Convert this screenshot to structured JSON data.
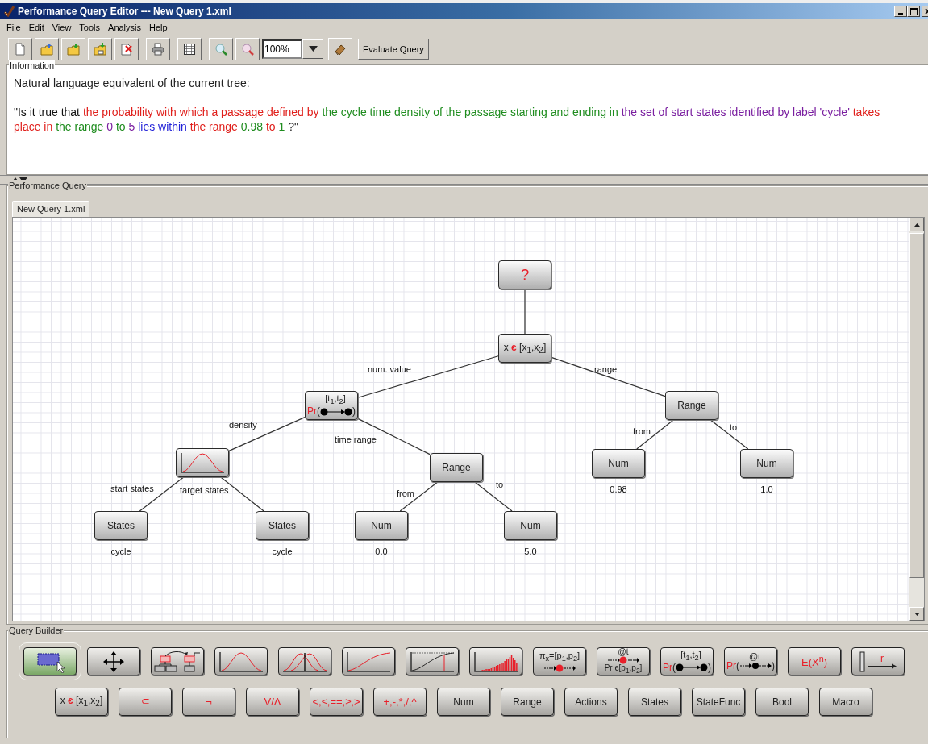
{
  "window": {
    "title": "Performance Query Editor --- New Query 1.xml"
  },
  "menu": [
    "File",
    "Edit",
    "View",
    "Tools",
    "Analysis",
    "Help"
  ],
  "toolbar": [
    {
      "kind": "new"
    },
    {
      "kind": "open"
    },
    {
      "kind": "import"
    },
    {
      "kind": "export"
    },
    {
      "kind": "close-file"
    },
    {
      "kind": "print"
    },
    {
      "kind": "grid"
    },
    {
      "kind": "zoom-in"
    },
    {
      "kind": "zoom-out"
    },
    {
      "kind": "zoom-select",
      "value": "100%"
    },
    {
      "kind": "eraser"
    },
    {
      "kind": "button",
      "label": "Evaluate Query"
    }
  ],
  "information": {
    "title": "Information",
    "heading": "Natural language equivalent of the current tree:",
    "sentence": [
      {
        "text": "\"Is it true that ",
        "color": "#111111"
      },
      {
        "text": "the probability with which a passage defined by ",
        "color": "#e0201c"
      },
      {
        "text": "the cycle time density of the passage starting and ending in ",
        "color": "#1e8c1e"
      },
      {
        "text": "the set of start states identified by label 'cycle' ",
        "color": "#7a1fa0"
      },
      {
        "text": "takes place in ",
        "color": "#e0201c"
      },
      {
        "text": "the range ",
        "color": "#1e8c1e"
      },
      {
        "text": "0",
        "color": "#7a1fa0"
      },
      {
        "text": " to ",
        "color": "#1e8c1e"
      },
      {
        "text": "5",
        "color": "#7a1fa0"
      },
      {
        "text": " lies within ",
        "color": "#2424d8"
      },
      {
        "text": "the range ",
        "color": "#e0201c"
      },
      {
        "text": "0.98",
        "color": "#1e8c1e"
      },
      {
        "text": " to ",
        "color": "#e0201c"
      },
      {
        "text": "1",
        "color": "#1e8c1e"
      },
      {
        "text": " ?\"",
        "color": "#111111"
      }
    ]
  },
  "performance_query": {
    "title": "Performance Query",
    "tabs": [
      {
        "label": "New Query 1.xml",
        "selected": true
      }
    ],
    "tree": {
      "kind": "placeholder",
      "label": "?",
      "children": [
        {
          "kind": "in-range",
          "label": "x",
          "symbol": "є",
          "operand": "[x$_{1}$,x$_{2}$]",
          "children": [
            {
              "kind": "passage",
              "edge": "num. value",
              "prefix": "Pr",
              "open": "(",
              "interval": "[t$_{1}$,t$_{2}$]",
              "close": ")",
              "children": [
                {
                  "kind": "density",
                  "edge": "density",
                  "children": [
                    {
                      "kind": "text",
                      "edge": "start states",
                      "label": "States",
                      "value": "cycle"
                    },
                    {
                      "kind": "text",
                      "edge": "target states",
                      "label": "States",
                      "value": "cycle"
                    }
                  ]
                },
                {
                  "kind": "text",
                  "edge": "time range",
                  "label": "Range",
                  "children": [
                    {
                      "kind": "text",
                      "edge": "from",
                      "label": "Num",
                      "value": "0.0"
                    },
                    {
                      "kind": "text",
                      "edge": "to",
                      "label": "Num",
                      "value": "5.0"
                    }
                  ]
                }
              ]
            },
            {
              "kind": "text",
              "edge": "range",
              "label": "Range",
              "children": [
                {
                  "kind": "text",
                  "edge": "from",
                  "label": "Num",
                  "value": "0.98"
                },
                {
                  "kind": "text",
                  "edge": "to",
                  "label": "Num",
                  "value": "1.0"
                }
              ]
            }
          ]
        }
      ]
    }
  },
  "query_builder": {
    "title": "Query Builder",
    "row_1": [
      {
        "kind": "select",
        "selected": true
      },
      {
        "kind": "move",
        "selected": false
      },
      {
        "kind": "macro-tree",
        "selected": false
      },
      {
        "kind": "density",
        "selected": false
      },
      {
        "kind": "multi-density",
        "selected": false
      },
      {
        "kind": "distribution",
        "selected": false
      },
      {
        "kind": "percentile",
        "selected": false
      },
      {
        "kind": "histogram",
        "selected": false
      },
      {
        "kind": "transient-dist",
        "label": "π$_{x}$=[p$_{1}$,p$_{2}$]",
        "selected": false
      },
      {
        "kind": "steady",
        "top": "@t",
        "bottom": "Pr є[p$_{1}$,p$_{2}$]",
        "selected": false
      },
      {
        "kind": "passage",
        "prefix": "Pr",
        "open": "(",
        "interval": "[t$_{1}$,t$_{2}$]",
        "close": ")",
        "selected": false
      },
      {
        "kind": "transient",
        "prefix": "Pr",
        "open": "(",
        "top": "@t",
        "close": ")",
        "selected": false
      },
      {
        "kind": "symbol",
        "label": "E(X$^{n}$)",
        "selected": false
      },
      {
        "kind": "reward",
        "label": "r",
        "selected": false
      }
    ],
    "row_2": [
      {
        "kind": "in-range",
        "label": "x",
        "symbol": "є",
        "operand": "[x$_{1}$,x$_{2}$]",
        "selected": false
      },
      {
        "kind": "symbol",
        "label": "⊆",
        "selected": false
      },
      {
        "kind": "symbol",
        "label": "¬",
        "selected": false
      },
      {
        "kind": "symbol",
        "label": "V/Λ",
        "selected": false
      },
      {
        "kind": "symbol",
        "label": "<,≤,==,≥,>",
        "selected": false
      },
      {
        "kind": "symbol",
        "label": "+,-,*,/,^",
        "selected": false
      },
      {
        "kind": "text",
        "label": "Num",
        "selected": false
      },
      {
        "kind": "text",
        "label": "Range",
        "selected": false
      },
      {
        "kind": "text",
        "label": "Actions",
        "selected": false
      },
      {
        "kind": "text",
        "label": "States",
        "selected": false
      },
      {
        "kind": "text",
        "label": "StateFunc",
        "selected": false
      },
      {
        "kind": "text",
        "label": "Bool",
        "selected": false
      },
      {
        "kind": "text",
        "label": "Macro",
        "selected": false
      }
    ]
  }
}
